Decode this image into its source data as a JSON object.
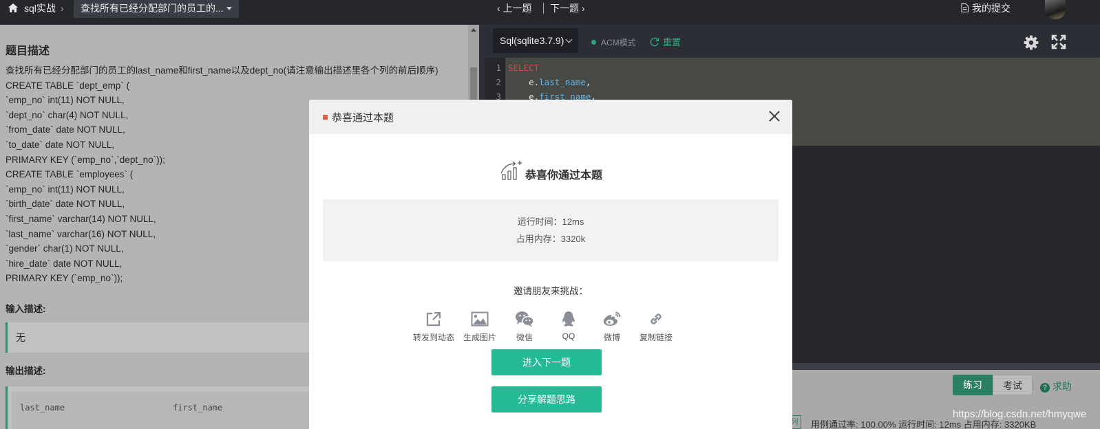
{
  "topbar": {
    "breadcrumb": "sql实战",
    "breadcrumb_sep": "›",
    "problem_select": "查找所有已经分配部门的员工的...",
    "prev": "‹ 上一题",
    "next": "下一题 ›",
    "my_submissions": "我的提交"
  },
  "problem": {
    "section_title": "题目描述",
    "description_lines": [
      "查找所有已经分配部门的员工的last_name和first_name以及dept_no(请注意输出描述里各个列的前后顺序)",
      "CREATE TABLE `dept_emp` (",
      "`emp_no` int(11) NOT NULL,",
      "`dept_no` char(4) NOT NULL,",
      "`from_date` date NOT NULL,",
      "`to_date` date NOT NULL,",
      "PRIMARY KEY (`emp_no`,`dept_no`));",
      "CREATE TABLE `employees` (",
      "`emp_no` int(11) NOT NULL,",
      "`birth_date` date NOT NULL,",
      "`first_name` varchar(14) NOT NULL,",
      "`last_name` varchar(16) NOT NULL,",
      "`gender` char(1) NOT NULL,",
      "`hire_date` date NOT NULL,",
      "PRIMARY KEY (`emp_no`));"
    ],
    "input_title": "输入描述:",
    "input_value": "无",
    "output_title": "输出描述:",
    "output_columns": [
      "last_name",
      "first_name"
    ]
  },
  "editor": {
    "language": "Sql(sqlite3.7.9)",
    "acm_mode": "ACM模式",
    "reset": "重置",
    "line_numbers": [
      "1",
      "2",
      "3"
    ],
    "code": {
      "line1_kw": "SELECT",
      "line2_prefix": "    e.",
      "line2_field": "last_name",
      "line2_suffix": ",",
      "line3_prefix": "    e.",
      "line3_field": "first_name",
      "line3_suffix": ","
    }
  },
  "bottom": {
    "practice": "练习",
    "exam": "考试",
    "help": "求助",
    "result_tag": "列",
    "result_text": "用例通过率: 100.00%  运行时间: 12ms  占用内存: 3320KB",
    "watermark": "https://blog.csdn.net/hmyqwe"
  },
  "modal": {
    "title": "恭喜通过本题",
    "success": "恭喜你通过本题",
    "runtime": "运行时间：12ms",
    "memory": "占用内存：3320k",
    "invite": "邀请朋友来挑战：",
    "share": [
      {
        "label": "转发到动态",
        "icon": "share-out-icon"
      },
      {
        "label": "生成图片",
        "icon": "image-icon"
      },
      {
        "label": "微信",
        "icon": "wechat-icon"
      },
      {
        "label": "QQ",
        "icon": "qq-icon"
      },
      {
        "label": "微博",
        "icon": "weibo-icon"
      },
      {
        "label": "复制链接",
        "icon": "link-icon"
      }
    ],
    "next_button": "进入下一题",
    "share_button": "分享解题思路"
  },
  "colors": {
    "accent_green": "#26b996",
    "mark_orange": "#e8573f",
    "keyword_red": "#d04a4a",
    "field_blue": "#67b4e8"
  }
}
